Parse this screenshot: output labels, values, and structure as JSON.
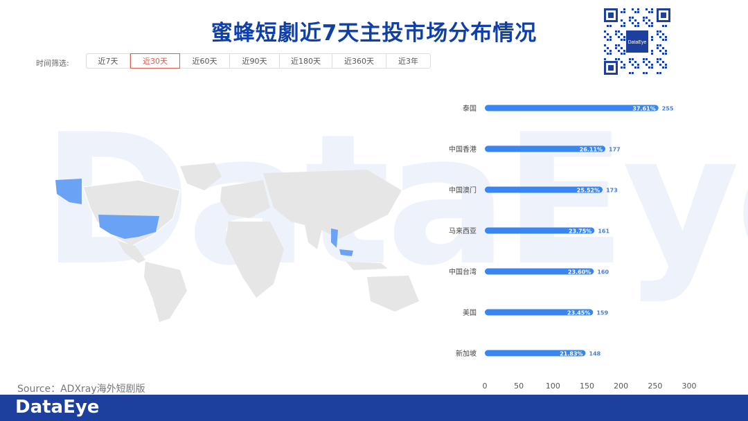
{
  "watermark": "DataEye",
  "title": "蜜蜂短劇近7天主投市场分布情况",
  "filter": {
    "label": "时间筛选:",
    "options": [
      "近7天",
      "近30天",
      "近60天",
      "近90天",
      "近180天",
      "近360天",
      "近3年"
    ],
    "selected": "近30天"
  },
  "qr": {
    "center_text": "DataEye"
  },
  "source": "Source：ADXray海外短剧版",
  "footer": {
    "brand": "DataEye"
  },
  "colors": {
    "accent": "#1d3f9e",
    "title": "#0f3fa8",
    "bar": "#3a86f0",
    "map_highlight": "#6aa3f5",
    "active_filter": "#e05a4a"
  },
  "chart_data": {
    "type": "bar",
    "orientation": "horizontal",
    "categories": [
      "泰国",
      "中国香港",
      "中国澳门",
      "马来西亚",
      "中国台湾",
      "美国",
      "新加坡"
    ],
    "values": [
      255,
      177,
      173,
      161,
      160,
      159,
      148
    ],
    "percent_labels": [
      "37.61%",
      "26.11%",
      "25.52%",
      "23.75%",
      "23.60%",
      "23.45%",
      "21.83%"
    ],
    "xlim": [
      0,
      300
    ],
    "xticks": [
      0,
      50,
      100,
      150,
      200,
      250,
      300
    ],
    "grid": false
  }
}
